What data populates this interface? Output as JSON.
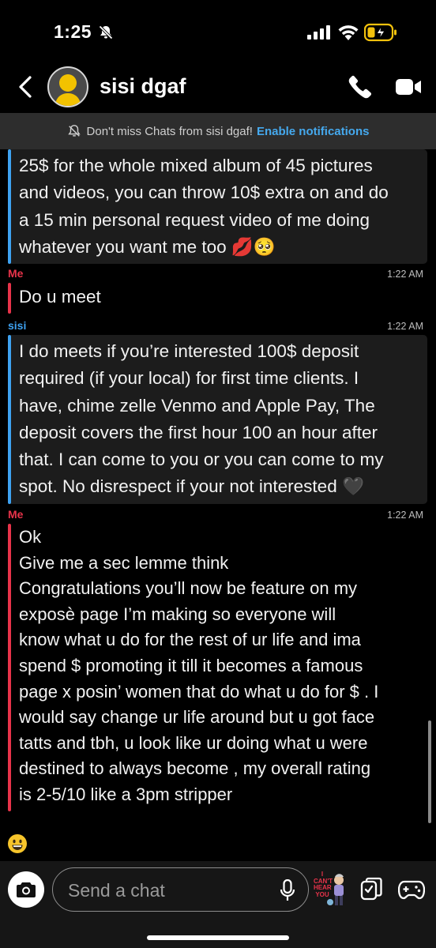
{
  "status_bar": {
    "time": "1:25"
  },
  "header": {
    "contact_name": "sisi dgaf"
  },
  "notification_banner": {
    "text": "Don't miss Chats from sisi dgaf!",
    "link": "Enable notifications"
  },
  "messages": [
    {
      "sender": "",
      "time": "",
      "lines": [
        "25$ for the whole mixed album of 45 pictures",
        "and videos, you can throw 10$ extra on and do",
        "a 15 min personal request video of me doing",
        "whatever you want me too 💋🥺"
      ]
    },
    {
      "sender": "Me",
      "time": "1:22 AM",
      "lines": [
        "Do u meet"
      ]
    },
    {
      "sender": "sisi",
      "time": "1:22 AM",
      "lines": [
        "I do meets if you’re interested 100$ deposit",
        "required (if your local) for first time clients.  I",
        "have, chime zelle Venmo and Apple Pay, The",
        "deposit covers the first hour 100 an hour after",
        "that.  I can come to you or you can come to my",
        "spot. No disrespect if your not interested 🖤"
      ]
    },
    {
      "sender": "Me",
      "time": "1:22 AM",
      "lines": [
        "Ok",
        "Give me a sec lemme think",
        "Congratulations you’ll now be feature on my",
        "exposè page I’m making so everyone will",
        "know what u do for the rest of ur life and ima",
        "spend $ promoting it till it becomes a famous",
        "page x posin’ women that do what u do for $ . I",
        "would say change ur life around but u got face",
        "tatts and tbh, u look like ur doing what u were",
        "destined to always become , my overall rating",
        "is 2-5/10 like a 3pm stripper"
      ]
    }
  ],
  "input_bar": {
    "placeholder": "Send a chat",
    "sticker_text": "I CAN'T HEAR YOU"
  },
  "colors": {
    "accent_blue": "#3ea2f1",
    "accent_red": "#e8334a",
    "link_blue": "#45a9ee"
  },
  "icons": [
    "bell-slash-icon",
    "signal-icon",
    "wifi-icon",
    "battery-charging-icon",
    "chevron-left-icon",
    "bitmoji-avatar",
    "phone-icon",
    "video-camera-icon",
    "camera-icon",
    "microphone-icon",
    "memories-icon",
    "game-controller-icon",
    "grinning-emoji-icon"
  ]
}
